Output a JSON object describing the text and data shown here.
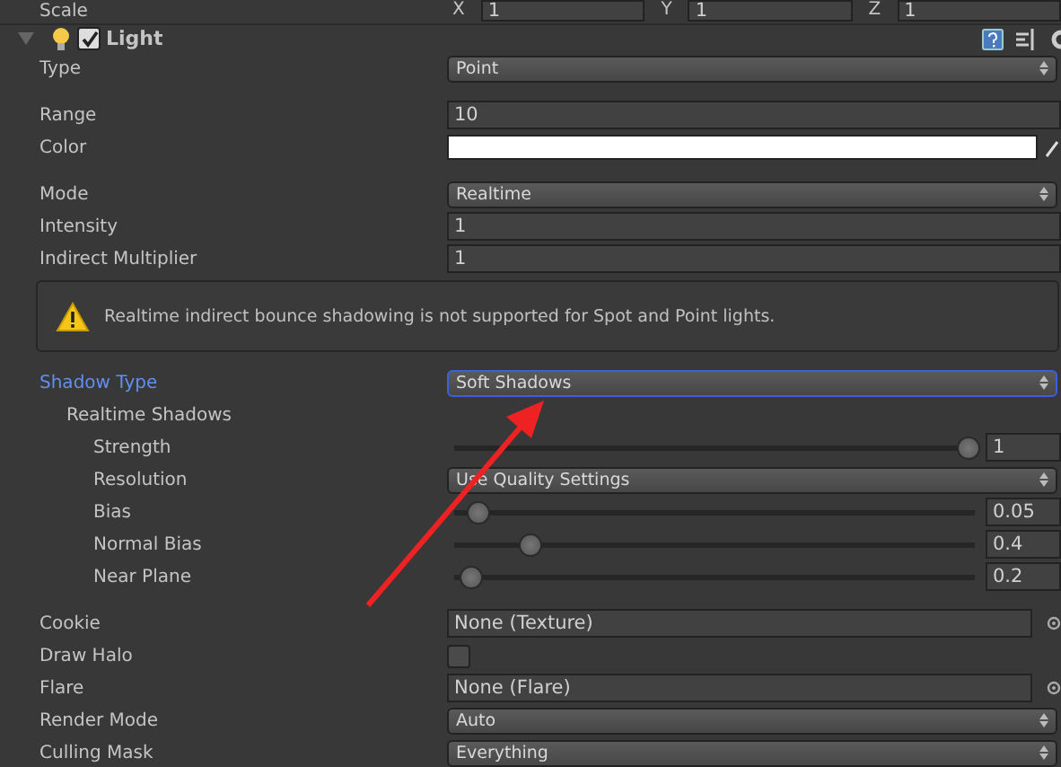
{
  "transform_row": {
    "label": "Scale",
    "fields": [
      {
        "axis": "X",
        "value": "1"
      },
      {
        "axis": "Y",
        "value": "1"
      },
      {
        "axis": "Z",
        "value": "1"
      }
    ]
  },
  "component": {
    "title": "Light",
    "enabled": true,
    "expanded": true
  },
  "groups": [
    [
      {
        "kind": "dropdown",
        "label": "Type",
        "value": "Point",
        "focused": false
      }
    ],
    [
      {
        "kind": "number",
        "label": "Range",
        "value": "10"
      },
      {
        "kind": "color",
        "label": "Color",
        "color": "#ffffff"
      }
    ],
    [
      {
        "kind": "dropdown",
        "label": "Mode",
        "value": "Realtime",
        "focused": false
      },
      {
        "kind": "number",
        "label": "Intensity",
        "value": "1"
      },
      {
        "kind": "number",
        "label": "Indirect Multiplier",
        "value": "1"
      }
    ],
    [
      {
        "kind": "warning",
        "text": "Realtime indirect bounce shadowing is not supported for Spot and Point lights."
      }
    ],
    [
      {
        "kind": "dropdown",
        "label": "Shadow Type",
        "value": "Soft Shadows",
        "focused": true,
        "children": [
          {
            "kind": "heading",
            "label": "Realtime Shadows",
            "children": [
              {
                "kind": "slider",
                "label": "Strength",
                "value": "1",
                "level": 1
              },
              {
                "kind": "dropdown",
                "label": "Resolution",
                "value": "Use Quality Settings",
                "focused": false
              },
              {
                "kind": "slider",
                "label": "Bias",
                "value": "0.05",
                "level": 0.025
              },
              {
                "kind": "slider",
                "label": "Normal Bias",
                "value": "0.4",
                "level": 0.13
              },
              {
                "kind": "slider",
                "label": "Near Plane",
                "value": "0.2",
                "level": 0.01
              }
            ]
          }
        ]
      }
    ],
    [
      {
        "kind": "object",
        "label": "Cookie",
        "value": "None (Texture)"
      },
      {
        "kind": "checkbox",
        "label": "Draw Halo",
        "checked": false
      },
      {
        "kind": "object",
        "label": "Flare",
        "value": "None (Flare)"
      },
      {
        "kind": "dropdown",
        "label": "Render Mode",
        "value": "Auto",
        "focused": false
      },
      {
        "kind": "dropdown",
        "label": "Culling Mask",
        "value": "Everything",
        "focused": false
      }
    ]
  ]
}
